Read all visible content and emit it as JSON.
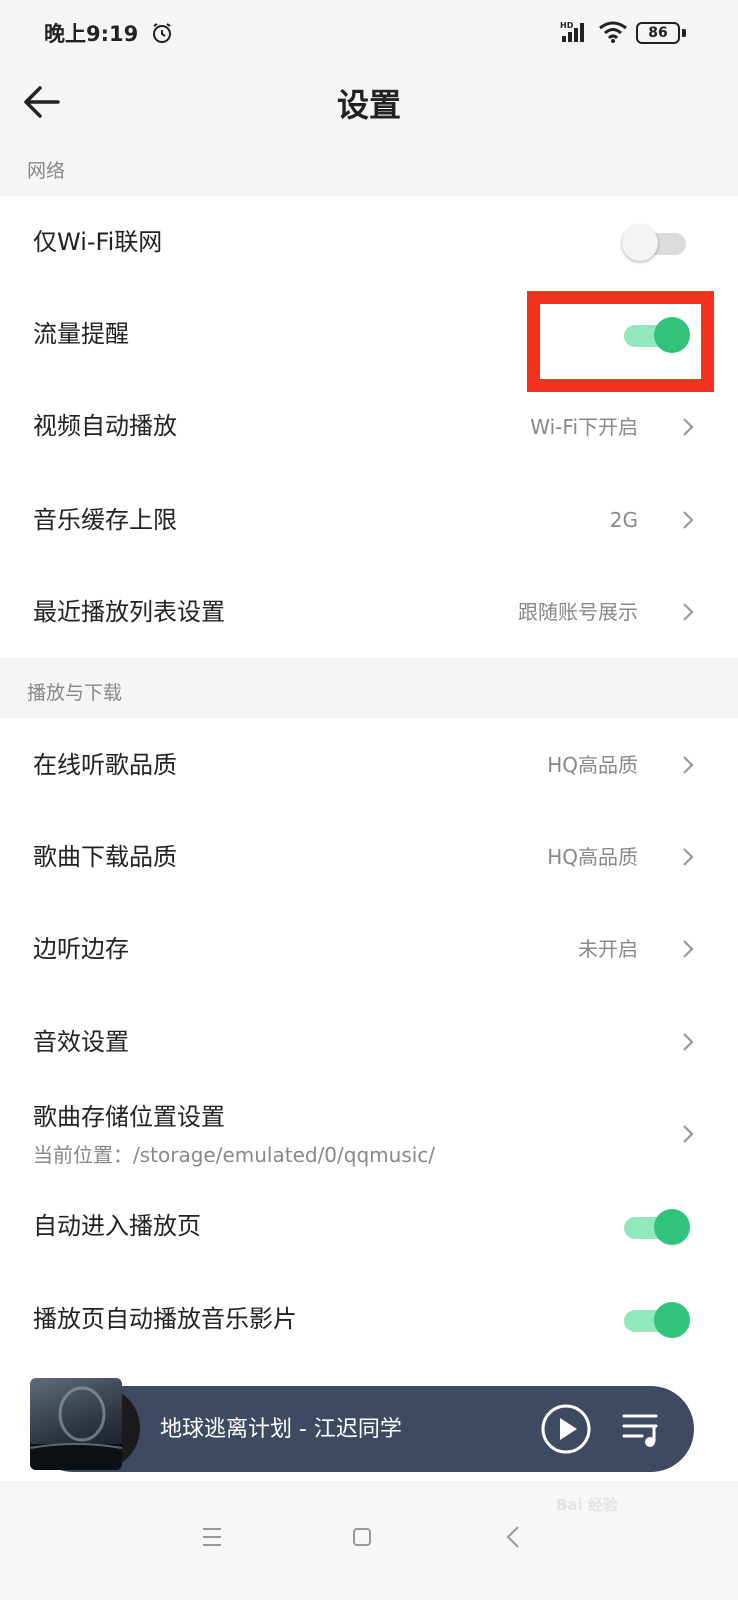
{
  "status": {
    "time": "晚上9:19",
    "network": "HD",
    "battery": "86"
  },
  "header": {
    "title": "设置"
  },
  "sections": {
    "network": {
      "label": "网络",
      "wifi_only": {
        "label": "仅Wi-Fi联网",
        "enabled": false
      },
      "data_reminder": {
        "label": "流量提醒",
        "enabled": true
      },
      "video_autoplay": {
        "label": "视频自动播放",
        "value": "Wi-Fi下开启"
      },
      "cache_limit": {
        "label": "音乐缓存上限",
        "value": "2G"
      },
      "recent_list": {
        "label": "最近播放列表设置",
        "value": "跟随账号展示"
      }
    },
    "playback": {
      "label": "播放与下载",
      "online_quality": {
        "label": "在线听歌品质",
        "value": "HQ高品质"
      },
      "download_quality": {
        "label": "歌曲下载品质",
        "value": "HQ高品质"
      },
      "listen_save": {
        "label": "边听边存",
        "value": "未开启"
      },
      "sound_effect": {
        "label": "音效设置"
      },
      "storage_location": {
        "label": "歌曲存储位置设置",
        "sub": "当前位置：/storage/emulated/0/qqmusic/"
      },
      "auto_enter_player": {
        "label": "自动进入播放页",
        "enabled": true
      },
      "auto_play_video": {
        "label": "播放页自动播放音乐影片",
        "enabled": true
      }
    }
  },
  "player": {
    "song": "地球逃离计划 - 江迟同学"
  },
  "colors": {
    "accent": "#31c27c",
    "highlight": "#f4321e",
    "player_bg": "#3e4a62"
  },
  "watermark": "Bai 经验"
}
